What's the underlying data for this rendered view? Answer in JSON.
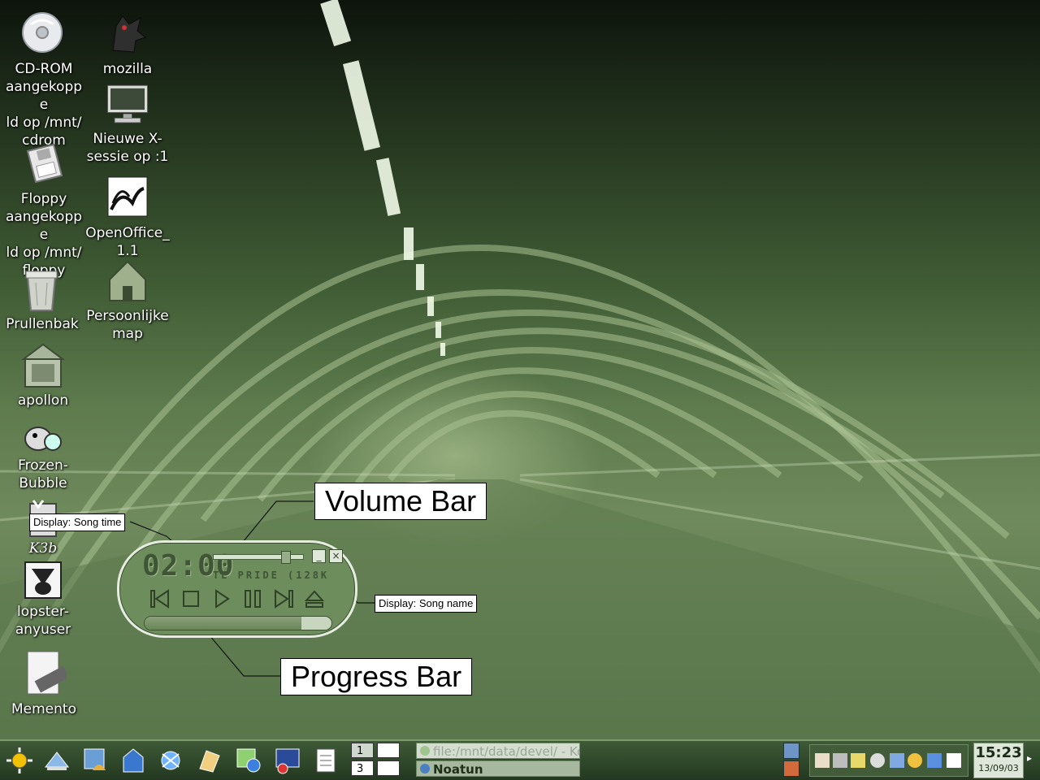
{
  "desktop": {
    "icons": [
      {
        "id": "cdrom",
        "label": "CD-ROM\naangekoppe\nld op /mnt/\ncdrom",
        "icon": "cdrom-icon"
      },
      {
        "id": "mozilla",
        "label": "mozilla",
        "icon": "mozilla-icon"
      },
      {
        "id": "xsession",
        "label": "Nieuwe X-\nsessie op :1",
        "icon": "monitor-icon"
      },
      {
        "id": "floppy",
        "label": "Floppy\naangekoppe\nld op /mnt/\nfloppy",
        "icon": "floppy-icon"
      },
      {
        "id": "openoffice",
        "label": "OpenOffice_\n1.1",
        "icon": "openoffice-icon"
      },
      {
        "id": "trash",
        "label": "Prullenbak",
        "icon": "trash-icon"
      },
      {
        "id": "home",
        "label": "Persoonlijke\nmap",
        "icon": "home-folder-icon"
      },
      {
        "id": "apollon",
        "label": "apollon",
        "icon": "apollon-icon"
      },
      {
        "id": "frozenbubble",
        "label": "Frozen-\nBubble",
        "icon": "frozen-bubble-icon"
      },
      {
        "id": "k3b",
        "label": "K3b",
        "icon": "k3b-icon"
      },
      {
        "id": "lopster",
        "label": "lopster-\nanyuser",
        "icon": "lopster-icon"
      },
      {
        "id": "memento",
        "label": "Memento",
        "icon": "memento-icon"
      }
    ]
  },
  "callouts": {
    "volume_bar": "Volume Bar",
    "progress_bar": "Progress Bar",
    "song_time": "Display: Song time",
    "song_name": "Display: Song name"
  },
  "player": {
    "time": "02:00",
    "song": "TE PRIDE (128K",
    "volume_fraction": 0.85,
    "progress_fraction": 0.84,
    "minimize": "_",
    "close": "×"
  },
  "taskbar": {
    "launchers": [
      "kmenu-icon",
      "desktop-icon",
      "konqueror-icon",
      "home-icon",
      "network-icon",
      "office-icon",
      "settings-icon",
      "terminal-icon",
      "screen-icon",
      "document-icon"
    ],
    "pager": {
      "desktops": [
        "1",
        "",
        "3",
        ""
      ]
    },
    "tasks": [
      {
        "label": "file:/mnt/data/devel/ - Ko",
        "active": false
      },
      {
        "label": "Noatun",
        "active": true
      }
    ],
    "clock": {
      "time": "15:23",
      "date": "13/09/03"
    }
  },
  "colors": {
    "player_body": "#6e8d5d",
    "lcd": "#3f5536",
    "taskbar": "#2f4a2a"
  }
}
